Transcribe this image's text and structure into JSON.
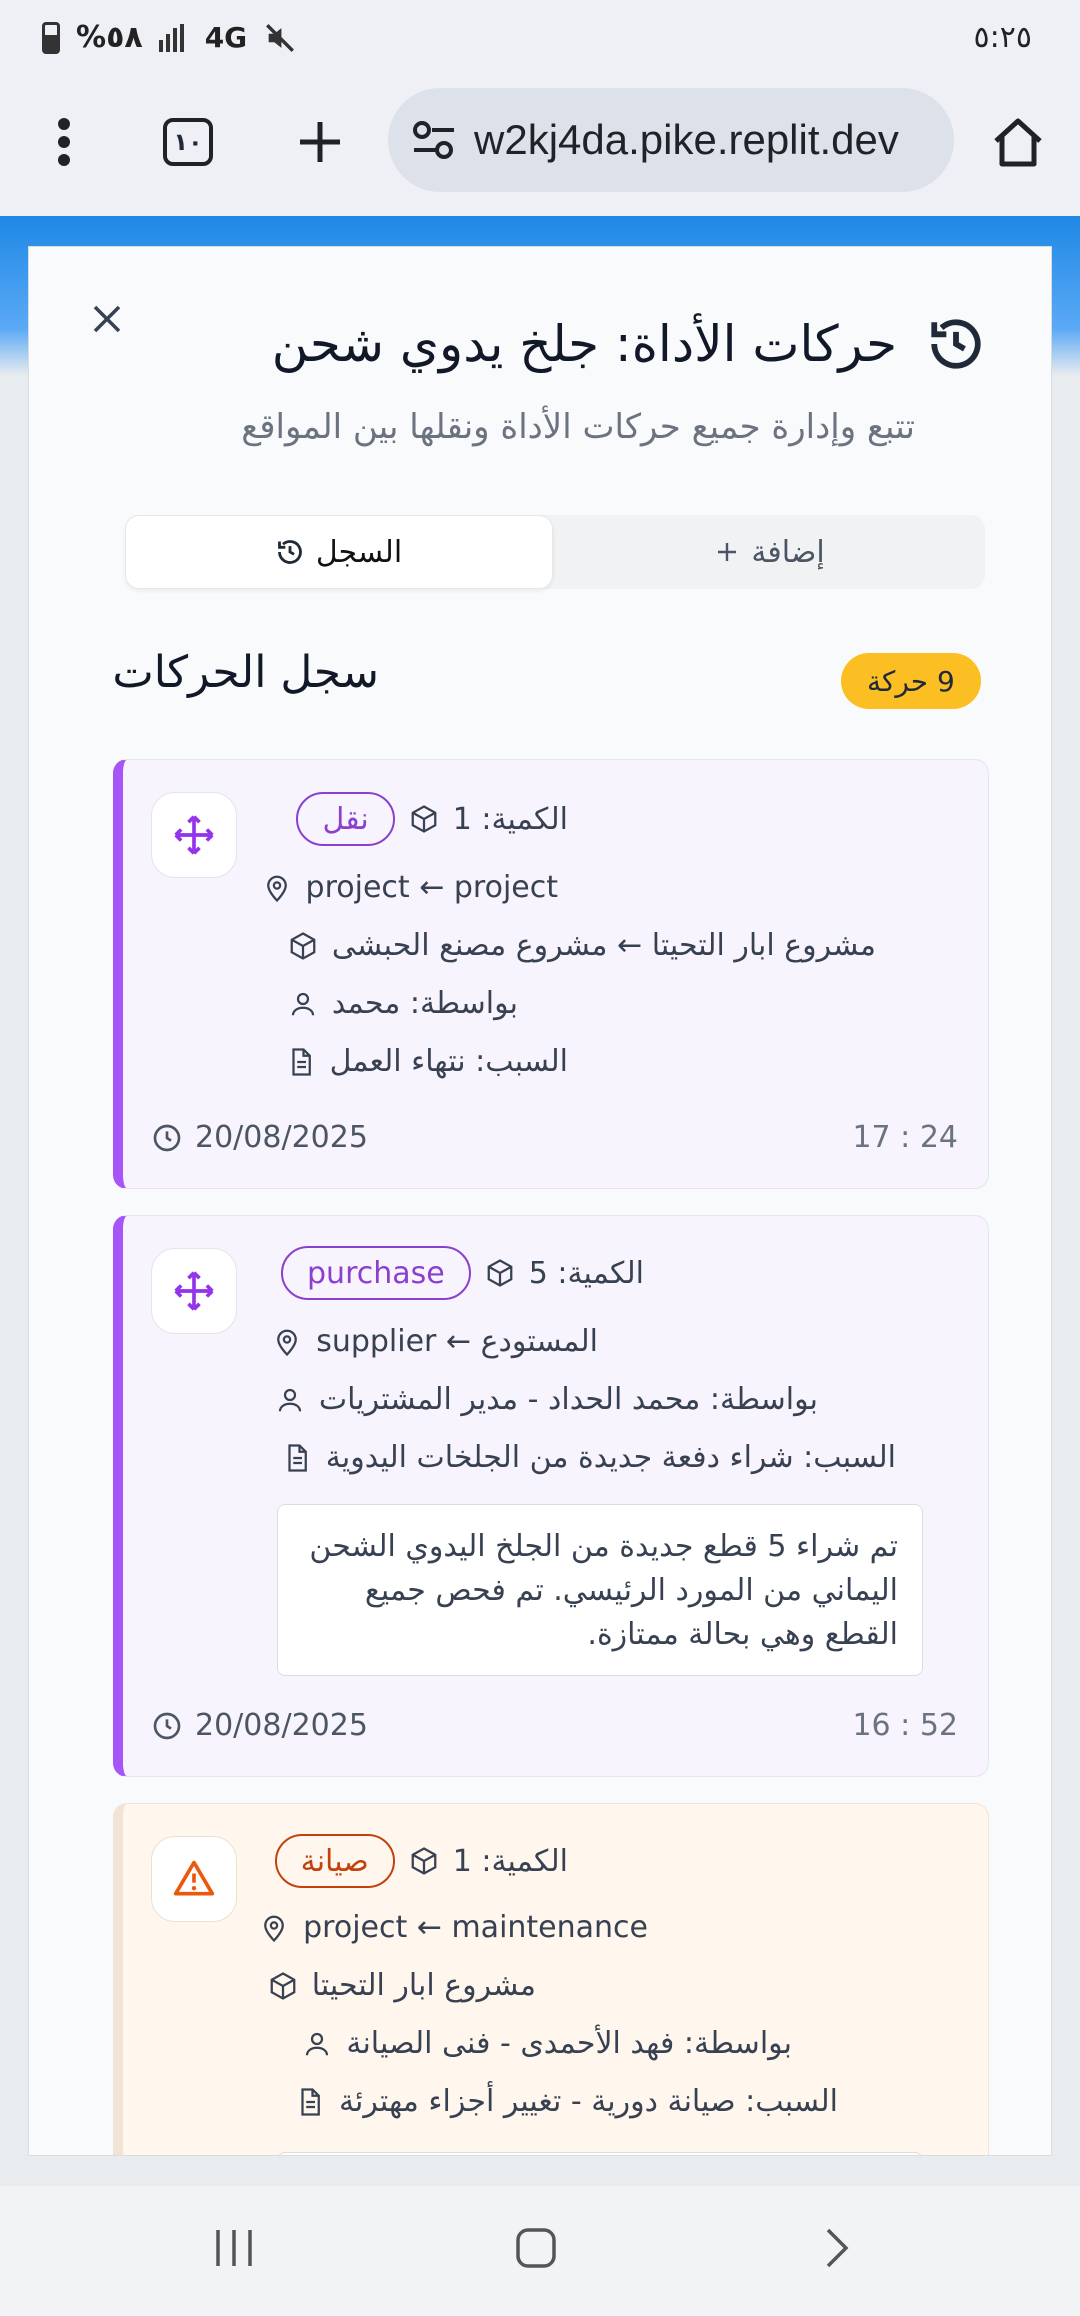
{
  "status_bar": {
    "time": "٥:٢٥",
    "battery": "%٥٨",
    "network": "4G"
  },
  "browser": {
    "url": "w2kj4da.pike.replit.dev",
    "tab_count": "١٠",
    "icons": [
      "more-vert-icon",
      "tabs-icon",
      "plus-icon",
      "site-settings-icon",
      "home-icon"
    ]
  },
  "modal": {
    "title": "حركات الأداة: جلخ يدوي شحن",
    "subtitle": "تتبع وإدارة جميع حركات الأداة ونقلها بين المواقع",
    "tabs": {
      "history": "السجل",
      "add": "إضافة"
    },
    "section_title": "سجل الحركات",
    "count_badge": "9 حركة"
  },
  "movements": [
    {
      "type": "نقل",
      "quantity": "الكمية: 1",
      "locations": "project ← project",
      "projects": "مشروع ابار التحيتا ← مشروع مصنع الحبشى",
      "by": "بواسطة: محمد",
      "reason": "السبب: نتهاء العمل",
      "date": "20/08/2025",
      "time": "17 : 24",
      "color": "#a855f7"
    },
    {
      "type": "purchase",
      "quantity": "الكمية: 5",
      "locations": "supplier ← المستودع",
      "by": "بواسطة: محمد الحداد - مدير المشتريات",
      "reason": "السبب: شراء دفعة جديدة من الجلخات اليدوية",
      "note": "تم شراء 5 قطع جديدة من الجلخ اليدوي الشحن اليماني من المورد الرئيسي. تم فحص جميع القطع وهي بحالة ممتازة.",
      "date": "20/08/2025",
      "time": "16 : 52",
      "color": "#a855f7"
    },
    {
      "type": "صيانة",
      "quantity": "الكمية: 1",
      "locations": "project ← maintenance",
      "projects": "مشروع ابار التحيتا",
      "by": "بواسطة: فهد الأحمدى - فنى الصيانة",
      "reason": "السبب: صيانة دورية - تغيير أجزاء مهترئة",
      "color": "#f97316"
    }
  ]
}
